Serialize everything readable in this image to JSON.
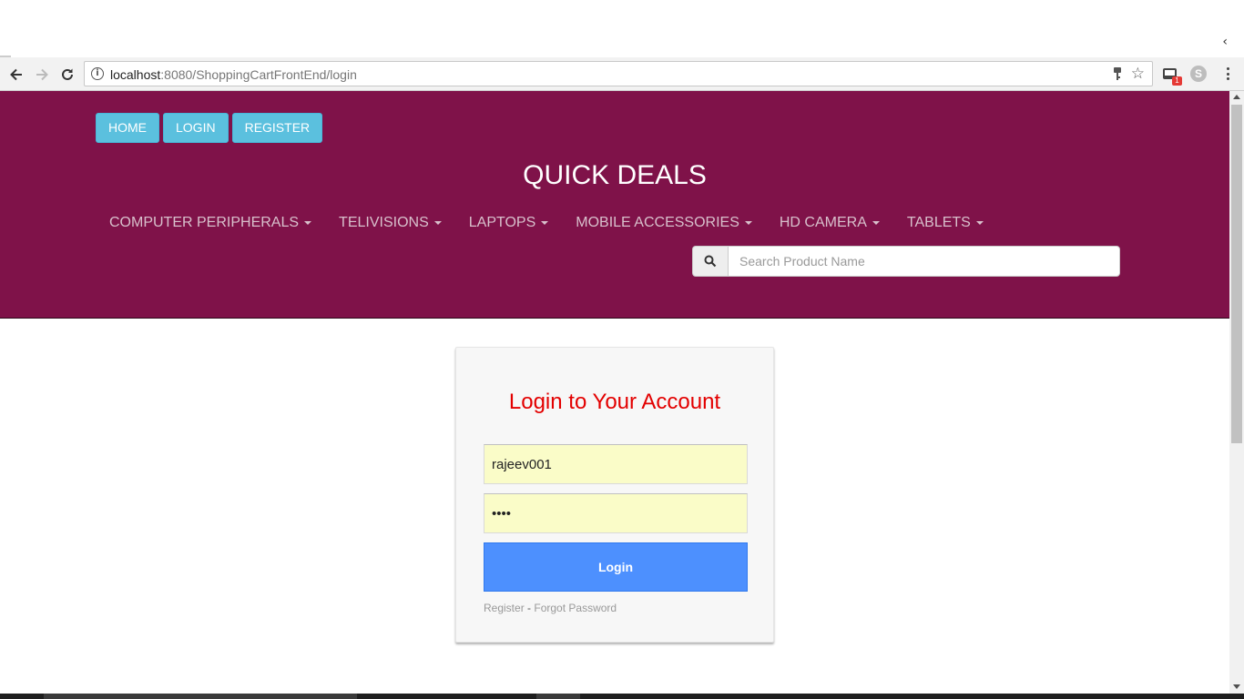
{
  "browser": {
    "url_host": "localhost",
    "url_path": ":8080/ShoppingCartFrontEnd/login",
    "extension_badge": "1",
    "skype_letter": "S",
    "corner_glyph": "‹"
  },
  "icons": {
    "back": "arrow-left-icon",
    "forward": "arrow-right-icon",
    "reload": "reload-icon",
    "info": "info-icon",
    "key": "key-icon",
    "star": "star-icon",
    "search": "search-icon",
    "menu": "more-vert-icon"
  },
  "header": {
    "buttons": [
      "HOME",
      "LOGIN",
      "REGISTER"
    ],
    "brand": "QUICK DEALS",
    "categories": [
      "COMPUTER PERIPHERALS",
      "TELIVISIONS",
      "LAPTOPS",
      "MOBILE ACCESSORIES",
      "HD CAMERA",
      "TABLETS"
    ],
    "search_placeholder": "Search Product Name"
  },
  "login": {
    "title": "Login to Your Account",
    "username_value": "rajeev001",
    "password_value": "••••",
    "submit_label": "Login",
    "register_link": "Register",
    "separator": "-",
    "forgot_link": "Forgot Password"
  },
  "colors": {
    "header_bg": "#7f1249",
    "button_info": "#5bc0de",
    "login_title": "#e30000",
    "login_button": "#4d90fe",
    "autofill_bg": "#fafcc8"
  }
}
